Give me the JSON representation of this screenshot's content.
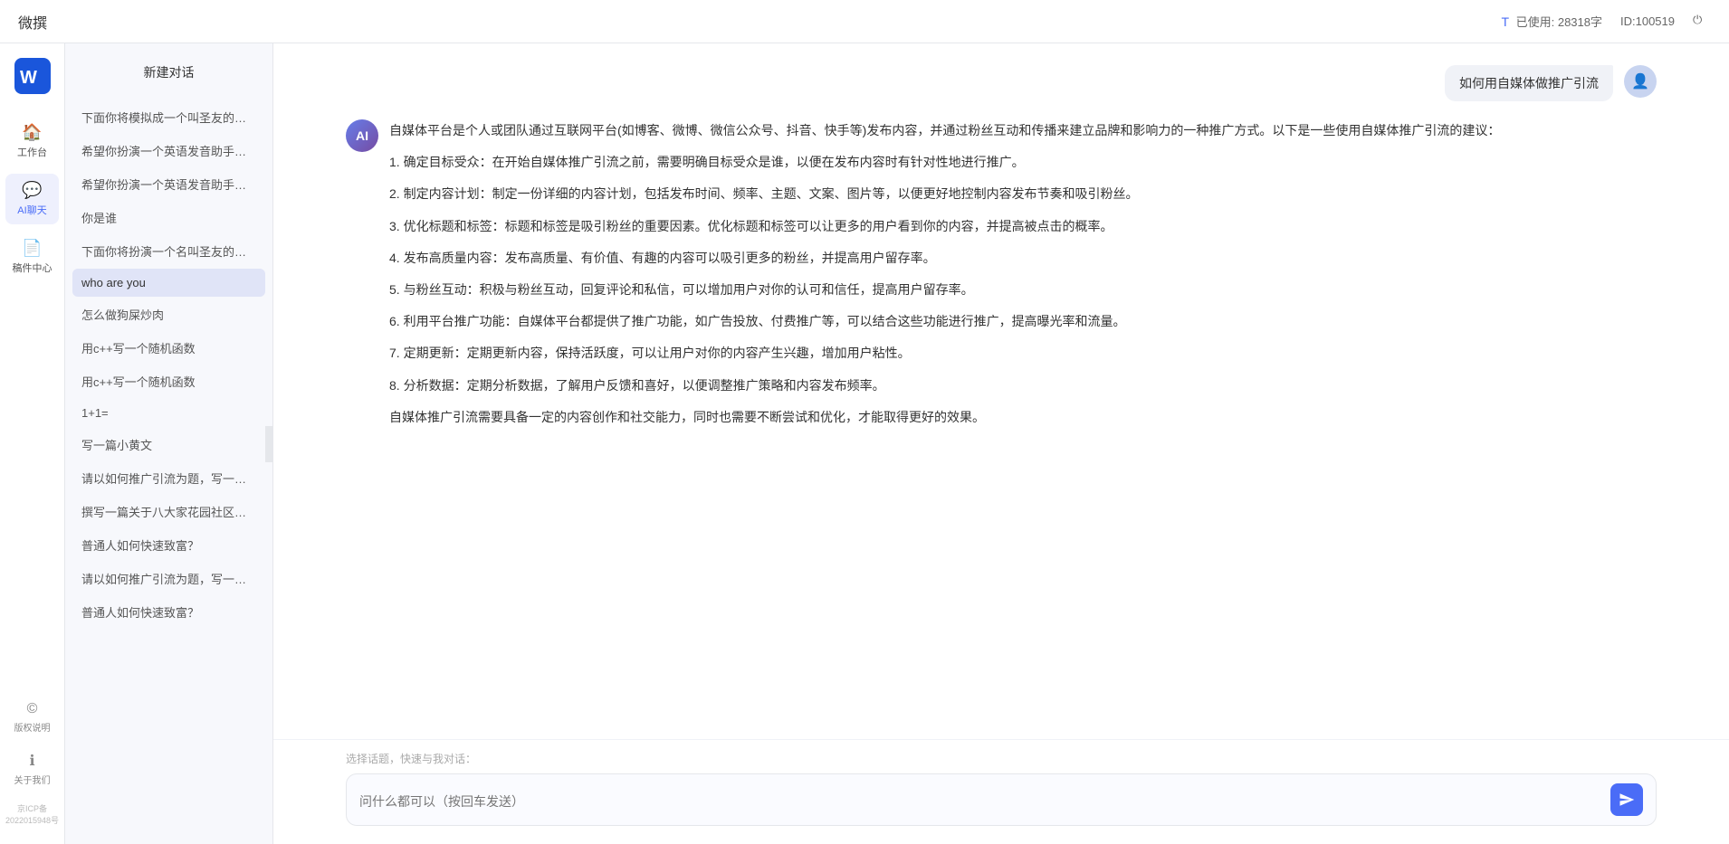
{
  "topbar": {
    "title": "微撰",
    "usage_label": "已使用: 28318字",
    "id_label": "ID:100519",
    "usage_icon": "T"
  },
  "left_nav": {
    "logo_text": "W 微撰",
    "items": [
      {
        "id": "workbench",
        "label": "工作台",
        "icon": "🏠"
      },
      {
        "id": "ai-chat",
        "label": "AI聊天",
        "icon": "💬",
        "active": true
      },
      {
        "id": "drafts",
        "label": "稿件中心",
        "icon": "📄"
      }
    ],
    "bottom_items": [
      {
        "id": "copyright",
        "label": "版权说明",
        "icon": "©"
      },
      {
        "id": "about",
        "label": "关于我们",
        "icon": "ℹ"
      }
    ],
    "icp": "京ICP备2022015948号"
  },
  "chat_sidebar": {
    "new_chat_label": "新建对话",
    "items": [
      {
        "id": 1,
        "text": "下面你将模拟成一个叫圣友的程序员，我说…",
        "active": false
      },
      {
        "id": 2,
        "text": "希望你扮演一个英语发音助手，我提供给你…",
        "active": false
      },
      {
        "id": 3,
        "text": "希望你扮演一个英语发音助手，我提供给你…",
        "active": false
      },
      {
        "id": 4,
        "text": "你是谁",
        "active": false
      },
      {
        "id": 5,
        "text": "下面你将扮演一个名叫圣友的医生",
        "active": false
      },
      {
        "id": 6,
        "text": "who are you",
        "active": true
      },
      {
        "id": 7,
        "text": "怎么做狗屎炒肉",
        "active": false
      },
      {
        "id": 8,
        "text": "用c++写一个随机函数",
        "active": false
      },
      {
        "id": 9,
        "text": "用c++写一个随机函数",
        "active": false
      },
      {
        "id": 10,
        "text": "1+1=",
        "active": false
      },
      {
        "id": 11,
        "text": "写一篇小黄文",
        "active": false
      },
      {
        "id": 12,
        "text": "请以如何推广引流为题，写一篇大纲",
        "active": false
      },
      {
        "id": 13,
        "text": "撰写一篇关于八大家花园社区一刻钟便民生…",
        "active": false
      },
      {
        "id": 14,
        "text": "普通人如何快速致富？",
        "active": false
      },
      {
        "id": 15,
        "text": "请以如何推广引流为题，写一篇大纲",
        "active": false
      },
      {
        "id": 16,
        "text": "普通人如何快速致富？",
        "active": false
      }
    ]
  },
  "chat": {
    "messages": [
      {
        "role": "user",
        "text": "如何用自媒体做推广引流",
        "avatar_icon": "👤"
      },
      {
        "role": "assistant",
        "paragraphs": [
          "自媒体平台是个人或团队通过互联网平台(如博客、微博、微信公众号、抖音、快手等)发布内容，并通过粉丝互动和传播来建立品牌和影响力的一种推广方式。以下是一些使用自媒体推广引流的建议：",
          "1. 确定目标受众：在开始自媒体推广引流之前，需要明确目标受众是谁，以便在发布内容时有针对性地进行推广。",
          "2. 制定内容计划：制定一份详细的内容计划，包括发布时间、频率、主题、文案、图片等，以便更好地控制内容发布节奏和吸引粉丝。",
          "3. 优化标题和标签：标题和标签是吸引粉丝的重要因素。优化标题和标签可以让更多的用户看到你的内容，并提高被点击的概率。",
          "4. 发布高质量内容：发布高质量、有价值、有趣的内容可以吸引更多的粉丝，并提高用户留存率。",
          "5. 与粉丝互动：积极与粉丝互动，回复评论和私信，可以增加用户对你的认可和信任，提高用户留存率。",
          "6. 利用平台推广功能：自媒体平台都提供了推广功能，如广告投放、付费推广等，可以结合这些功能进行推广，提高曝光率和流量。",
          "7. 定期更新：定期更新内容，保持活跃度，可以让用户对你的内容产生兴趣，增加用户粘性。",
          "8. 分析数据：定期分析数据，了解用户反馈和喜好，以便调整推广策略和内容发布频率。",
          "自媒体推广引流需要具备一定的内容创作和社交能力，同时也需要不断尝试和优化，才能取得更好的效果。"
        ]
      }
    ],
    "input_placeholder": "问什么都可以（按回车发送）",
    "quick_topics_label": "选择话题，快速与我对话："
  }
}
